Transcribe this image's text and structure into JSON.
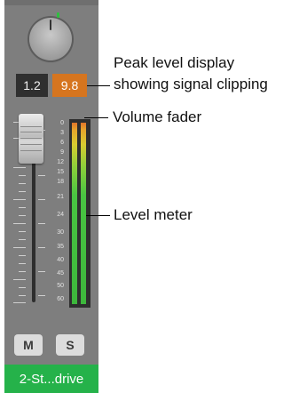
{
  "channel_strip": {
    "volume_value": "1.2",
    "peak_value": "9.8",
    "scale_labels": [
      "0",
      "3",
      "6",
      "9",
      "12",
      "15",
      "18",
      "21",
      "24",
      "30",
      "35",
      "40",
      "45",
      "50",
      "60"
    ],
    "mute_label": "M",
    "solo_label": "S",
    "track_name": "2-St...drive",
    "colors": {
      "strip_bg": "#7e7e7e",
      "peak_clip": "#d6751f",
      "track_name_bg": "#25b24a",
      "meter_green": "#3db73c",
      "meter_orange": "#e0742a"
    }
  },
  "callouts": {
    "peak_line1": "Peak level display",
    "peak_line2": "showing signal clipping",
    "volume_fader": "Volume fader",
    "level_meter": "Level meter"
  }
}
